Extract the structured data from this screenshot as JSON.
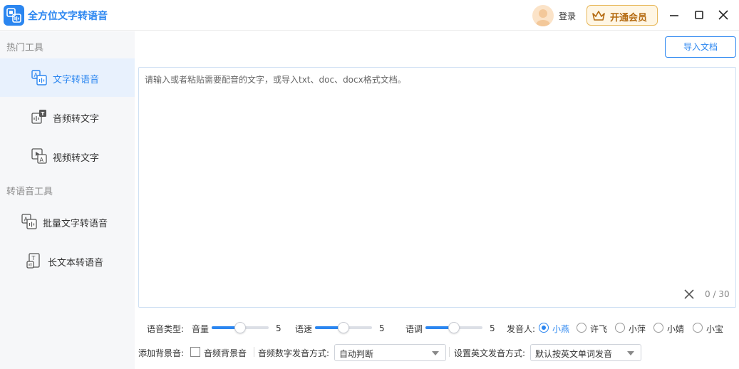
{
  "app": {
    "title": "全方位文字转语音",
    "accent": "#2b86f0"
  },
  "header": {
    "login_label": "登录",
    "vip_label": "开通会员"
  },
  "sidebar": {
    "section_hot": "热门工具",
    "section_tts": "转语音工具",
    "items": [
      {
        "label": "文字转语音",
        "icon": "text-to-speech-icon",
        "active": true
      },
      {
        "label": "音频转文字",
        "icon": "audio-to-text-icon"
      },
      {
        "label": "视频转文字",
        "icon": "video-to-text-icon"
      },
      {
        "label": "批量文字转语音",
        "icon": "batch-text-to-speech-icon"
      },
      {
        "label": "长文本转语音",
        "icon": "long-text-to-speech-icon"
      }
    ]
  },
  "main": {
    "import_label": "导入文档",
    "editor_placeholder": "请输入或者粘贴需要配音的文字，或导入txt、doc、docx格式文档。",
    "char_count": "0 / 30"
  },
  "controls": {
    "voice_type_label": "语音类型:",
    "volume": {
      "label": "音量",
      "value": "5",
      "level": 0.5
    },
    "speed": {
      "label": "语速",
      "value": "5",
      "level": 0.5
    },
    "pitch": {
      "label": "语调",
      "value": "5",
      "level": 0.5
    },
    "speaker_label": "发音人:",
    "speakers": [
      "小燕",
      "许飞",
      "小萍",
      "小婧",
      "小宝"
    ],
    "selected_speaker": "小燕",
    "bg_music_label": "添加背景音:",
    "bg_music_checkbox_label": "音频背景音",
    "bg_music_checked": false,
    "number_mode_label": "音频数字发音方式:",
    "number_mode_value": "自动判断",
    "english_mode_label": "设置英文发音方式:",
    "english_mode_value": "默认按英文单词发音"
  }
}
